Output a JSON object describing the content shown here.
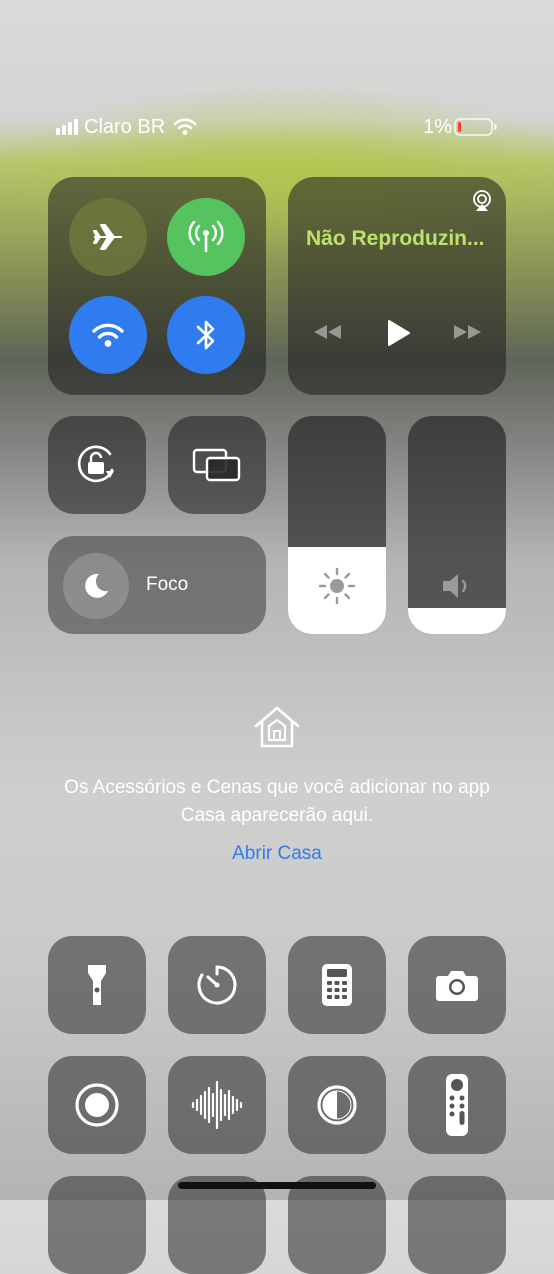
{
  "status_bar": {
    "carrier": "Claro BR",
    "battery": "1%",
    "signal_bars": 4,
    "battery_level": 0.01,
    "battery_color": "#ff3b30"
  },
  "connectivity": {
    "airplane_mode": false,
    "cellular_data": true,
    "wifi": true,
    "bluetooth": true,
    "active_green": "#55c45e",
    "active_blue": "#2f7bf0"
  },
  "now_playing": {
    "title": "Não Reproduzin...",
    "title_color": "#bfe06a",
    "icons": [
      "airplay-icon",
      "rewind-icon",
      "play-icon",
      "fast-forward-icon"
    ]
  },
  "focus": {
    "label": "Foco"
  },
  "brightness": {
    "level": 0.4
  },
  "volume": {
    "level": 0.12
  },
  "home": {
    "message": "Os Acessórios e Cenas que você adicionar no app Casa aparecerão aqui.",
    "link": "Abrir Casa"
  },
  "shortcuts": [
    "flashlight-icon",
    "timer-icon",
    "calculator-icon",
    "camera-icon",
    "screen-record-icon",
    "voice-memo-icon",
    "dark-mode-icon",
    "apple-tv-remote-icon"
  ]
}
